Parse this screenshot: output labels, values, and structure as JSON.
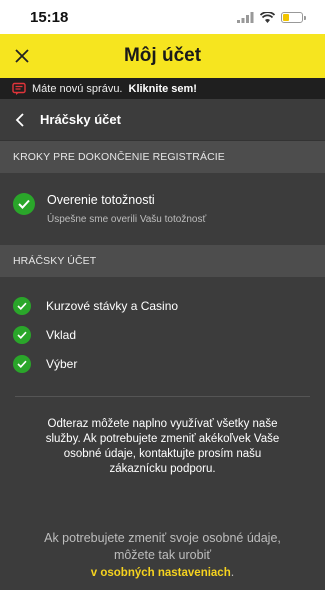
{
  "status": {
    "time": "15:18",
    "battery_level": 0.35
  },
  "header": {
    "title": "Môj účet",
    "close_icon": "close-icon"
  },
  "notice": {
    "text": "Máte novú správu.",
    "link": "Kliknite sem!"
  },
  "subheader": {
    "title": "Hráčsky účet",
    "back_icon": "chevron-left-icon"
  },
  "registration": {
    "section_title": "KROKY PRE DOKONČENIE REGISTRÁCIE",
    "item": {
      "title": "Overenie totožnosti",
      "subtitle": "Úspešne sme overili Vašu totožnosť"
    }
  },
  "account": {
    "section_title": "HRÁČSKY ÚČET",
    "items": [
      {
        "label": "Kurzové stávky a Casino"
      },
      {
        "label": "Vklad"
      },
      {
        "label": "Výber"
      }
    ]
  },
  "info": {
    "text": "Odteraz môžete naplno využívať všetky naše služby. Ak potrebujete zmeniť akékoľvek Vaše osobné údaje, kontaktujte prosím našu zákaznícku podporu."
  },
  "footer": {
    "line1": "Ak potrebujete zmeniť svoje osobné údaje,",
    "line2": "môžete tak urobiť",
    "link": "v osobných nastaveniach",
    "suffix": "."
  },
  "colors": {
    "accent": "#f6e51f",
    "success": "#2aa62a",
    "link": "#f6d31f"
  }
}
